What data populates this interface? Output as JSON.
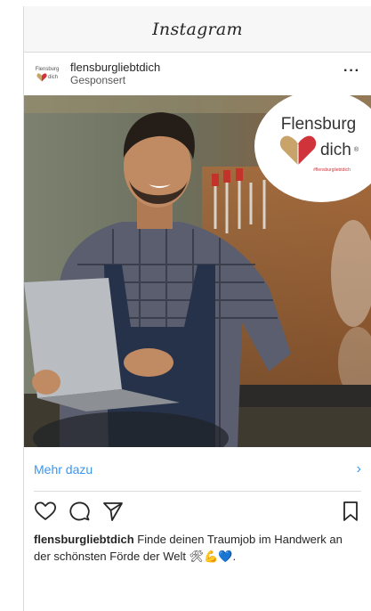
{
  "header": {
    "title": "Instagram"
  },
  "post": {
    "account": "flensburgliebtdich",
    "label": "Gesponsert",
    "more_label": "···",
    "avatar": {
      "word": "Flensburg",
      "dich": "dich"
    }
  },
  "ad_badge": {
    "word": "Flensburg",
    "dich": "dich",
    "mark": "®",
    "hashtag": "#flensburgliebtdich"
  },
  "cta": {
    "label": "Mehr dazu",
    "chevron": "›"
  },
  "caption": {
    "user": "flensburgliebtdich",
    "text": "Finde deinen Traumjob im Handwerk an der schönsten Förde der Welt 🛠💪💙."
  },
  "icons": [
    "heart-icon",
    "comment-icon",
    "send-icon",
    "bookmark-icon"
  ],
  "colors": {
    "link": "#3897f0",
    "text": "#262626",
    "heart_red": "#d0343a",
    "heart_gold": "#c9a46a"
  }
}
